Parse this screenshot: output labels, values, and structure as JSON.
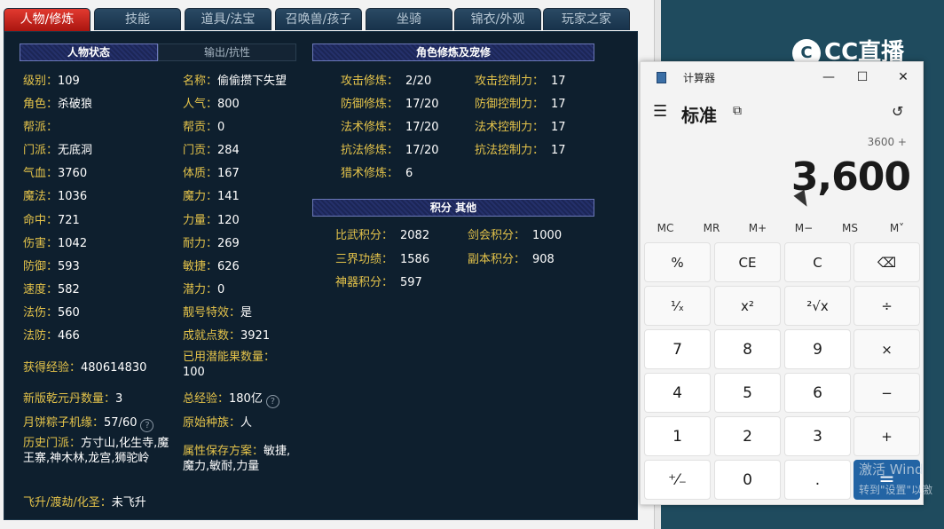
{
  "game": {
    "tabs": [
      "人物/修炼",
      "技能",
      "道具/法宝",
      "召唤兽/孩子",
      "坐骑",
      "锦衣/外观",
      "玩家之家"
    ],
    "headers": {
      "status": "人物状态",
      "output": "输出/抗性",
      "cultivation": "角色修炼及宠修",
      "points": "积分 其他"
    },
    "col1": [
      {
        "k": "级别：",
        "v": "109"
      },
      {
        "k": "角色：",
        "v": "杀破狼"
      },
      {
        "k": "帮派：",
        "v": ""
      },
      {
        "k": "门派：",
        "v": "无底洞"
      },
      {
        "k": "气血：",
        "v": "3760"
      },
      {
        "k": "魔法：",
        "v": "1036"
      },
      {
        "k": "命中：",
        "v": "721"
      },
      {
        "k": "伤害：",
        "v": "1042"
      },
      {
        "k": "防御：",
        "v": "593"
      },
      {
        "k": "速度：",
        "v": "582"
      },
      {
        "k": "法伤：",
        "v": "560"
      },
      {
        "k": "法防：",
        "v": "466"
      }
    ],
    "col2": [
      {
        "k": "名称：",
        "v": "偷偷攒下失望"
      },
      {
        "k": "人气：",
        "v": "800"
      },
      {
        "k": "帮贡：",
        "v": "0"
      },
      {
        "k": "门贡：",
        "v": "284"
      },
      {
        "k": "体质：",
        "v": "167"
      },
      {
        "k": "魔力：",
        "v": "141"
      },
      {
        "k": "力量：",
        "v": "120"
      },
      {
        "k": "耐力：",
        "v": "269"
      },
      {
        "k": "敏捷：",
        "v": "626"
      },
      {
        "k": "潜力：",
        "v": "0"
      },
      {
        "k": "靓号特效：",
        "v": "是"
      },
      {
        "k": "成就点数：",
        "v": "3921"
      }
    ],
    "extra": {
      "exp": {
        "k": "获得经验：",
        "v": "480614830"
      },
      "potion": {
        "k": "已用潜能果数量：",
        "v": "100"
      },
      "qianyuan": {
        "k": "新版乾元丹数量：",
        "v": "3"
      },
      "total_exp": {
        "k": "总经验：",
        "v": "180亿"
      },
      "mooncake": {
        "k": "月饼粽子机缘：",
        "v": "57/60"
      },
      "race": {
        "k": "原始种族：",
        "v": "人"
      },
      "history": {
        "k": "历史门派：",
        "v": "方寸山,化生寺,魔王寨,神木林,龙宫,狮驼岭"
      },
      "attr_plan": {
        "k": "属性保存方案：",
        "v": "敏捷,魔力,敏耐,力量"
      },
      "ascend": {
        "k": "飞升/渡劫/化圣：",
        "v": "未飞升"
      },
      "help_glyph": "?"
    },
    "cultivation": [
      {
        "k": "攻击修炼：",
        "v": "2/20",
        "k2": "攻击控制力：",
        "v2": "17"
      },
      {
        "k": "防御修炼：",
        "v": "17/20",
        "k2": "防御控制力：",
        "v2": "17"
      },
      {
        "k": "法术修炼：",
        "v": "17/20",
        "k2": "法术控制力：",
        "v2": "17"
      },
      {
        "k": "抗法修炼：",
        "v": "17/20",
        "k2": "抗法控制力：",
        "v2": "17"
      },
      {
        "k": "猎术修炼：",
        "v": "6",
        "k2": "",
        "v2": ""
      }
    ],
    "points": [
      {
        "k": "比武积分：",
        "v": "2082",
        "k2": "剑会积分：",
        "v2": "1000"
      },
      {
        "k": "三界功绩：",
        "v": "1586",
        "k2": "副本积分：",
        "v2": "908"
      },
      {
        "k": "神器积分：",
        "v": "597",
        "k2": "",
        "v2": ""
      }
    ]
  },
  "logo": {
    "mark": "C",
    "text": "CC直播"
  },
  "calculator": {
    "app_name": "计算器",
    "mode": "标准",
    "expression": "3600 +",
    "display": "3,600",
    "window_buttons": [
      "—",
      "☐",
      "✕"
    ],
    "menu_glyph": "☰",
    "keep_glyph": "⧉",
    "history_glyph": "↺",
    "memory": [
      "MC",
      "MR",
      "M+",
      "M−",
      "MS",
      "M˅"
    ],
    "keys": [
      [
        "%",
        "CE",
        "C",
        "⌫"
      ],
      [
        "¹⁄ₓ",
        "x²",
        "²√x",
        "÷"
      ],
      [
        "7",
        "8",
        "9",
        "×"
      ],
      [
        "4",
        "5",
        "6",
        "−"
      ],
      [
        "1",
        "2",
        "3",
        "+"
      ],
      [
        "⁺⁄₋",
        "0",
        ".",
        "="
      ]
    ]
  },
  "watermark": {
    "line1": "激活 Wind",
    "line2": "转到\"设置\"以激"
  }
}
